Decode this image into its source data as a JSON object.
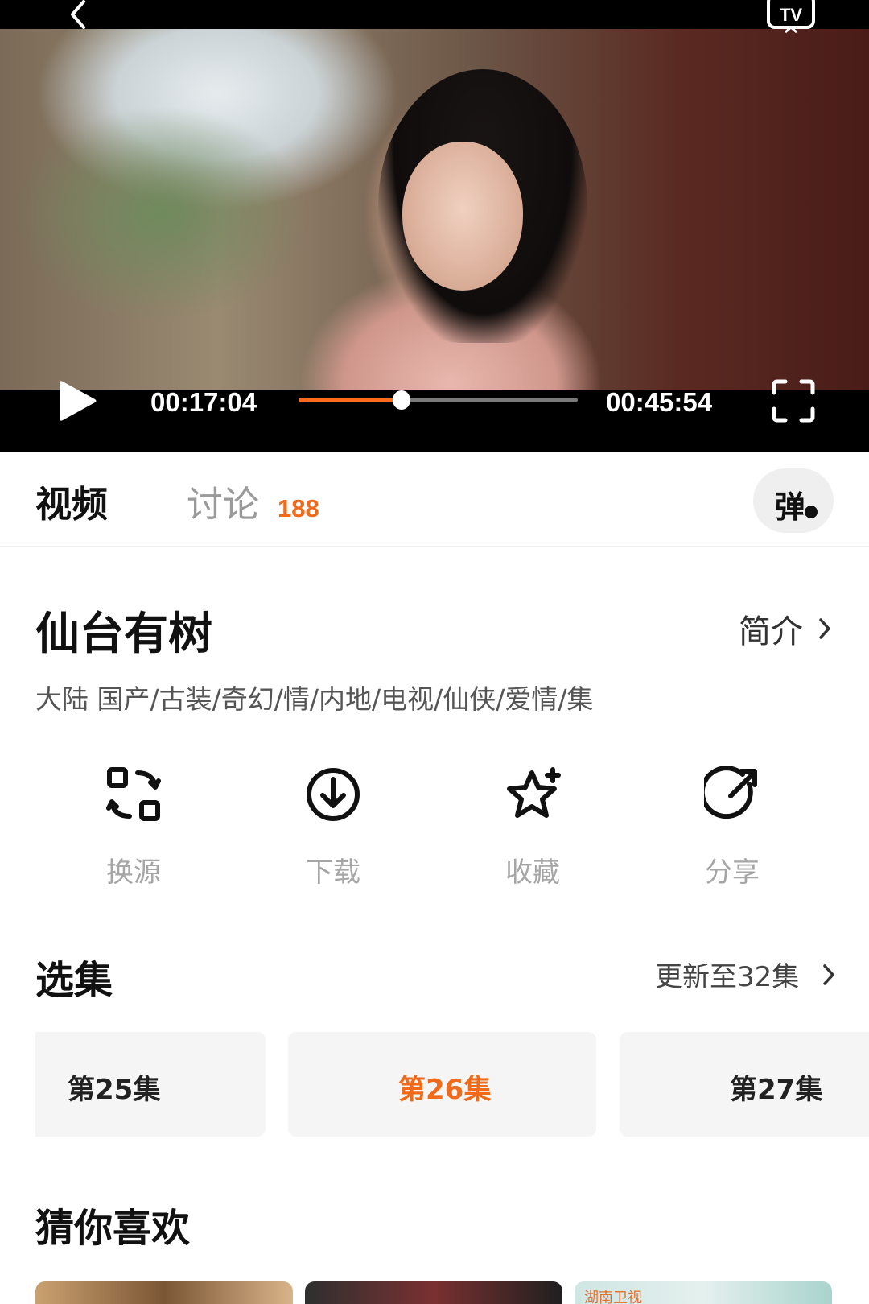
{
  "player": {
    "current_time": "00:17:04",
    "total_time": "00:45:54",
    "progress": 0.37,
    "accent_color": "#ff6a1a"
  },
  "icons": {
    "back": "chevron-left-icon",
    "tv": "tv-cast-icon",
    "play": "play-icon",
    "fullscreen": "fullscreen-icon"
  },
  "tabs": [
    {
      "label": "视频",
      "active": true
    },
    {
      "label": "讨论",
      "count": "188",
      "active": false
    }
  ],
  "danmu": {
    "label": "弹"
  },
  "show": {
    "title": "仙台有树",
    "intro_label": "简介",
    "tags": "大陆  国产/古装/奇幻/情/内地/电视/仙侠/爱情/集"
  },
  "actions": [
    {
      "label": "换源",
      "icon": "switch-source-icon"
    },
    {
      "label": "下载",
      "icon": "download-icon"
    },
    {
      "label": "收藏",
      "icon": "favorite-star-icon"
    },
    {
      "label": "分享",
      "icon": "share-icon"
    }
  ],
  "episodes": {
    "title": "选集",
    "update_text": "更新至32集",
    "items": [
      {
        "label": "第25集",
        "active": false
      },
      {
        "label": "第26集",
        "active": true
      },
      {
        "label": "第27集",
        "active": false
      }
    ]
  },
  "recommend": {
    "title": "猜你喜欢",
    "badge": "湖南卫视"
  }
}
